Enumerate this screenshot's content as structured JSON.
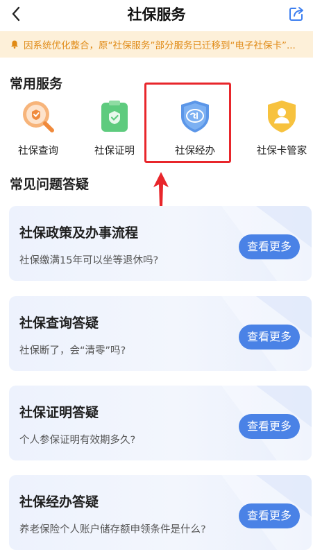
{
  "header": {
    "title": "社保服务",
    "back_icon": "chevron-left-icon",
    "share_icon": "share-icon"
  },
  "notice": {
    "icon": "bell-icon",
    "text": "因系统优化整合，原“社保服务”部分服务已迁移到“电子社保卡”..."
  },
  "common_services": {
    "title": "常用服务",
    "items": [
      {
        "label": "社保查询",
        "icon": "search-magnifier-icon",
        "color": "#f08a3c"
      },
      {
        "label": "社保证明",
        "icon": "clipboard-check-icon",
        "color": "#5ecb7e"
      },
      {
        "label": "社保经办",
        "icon": "si-shield-icon",
        "color": "#5b96e8"
      },
      {
        "label": "社保卡管家",
        "icon": "user-shield-icon",
        "color": "#f7c23e"
      }
    ]
  },
  "faq": {
    "title": "常见问题答疑",
    "cards": [
      {
        "title": "社保政策及办事流程",
        "subtitle": "社保缴满15年可以坐等退休吗?",
        "button": "查看更多"
      },
      {
        "title": "社保查询答疑",
        "subtitle": "社保断了，会“清零”吗?",
        "button": "查看更多"
      },
      {
        "title": "社保证明答疑",
        "subtitle": "个人参保证明有效期多久?",
        "button": "查看更多"
      },
      {
        "title": "社保经办答疑",
        "subtitle": "养老保险个人账户储存额申领条件是什么?",
        "button": "查看更多"
      }
    ]
  },
  "colors": {
    "accent_blue": "#4a82e6",
    "notice_bg": "#fdf0d9",
    "notice_text": "#e08a16",
    "highlight_red": "#e8262b"
  }
}
